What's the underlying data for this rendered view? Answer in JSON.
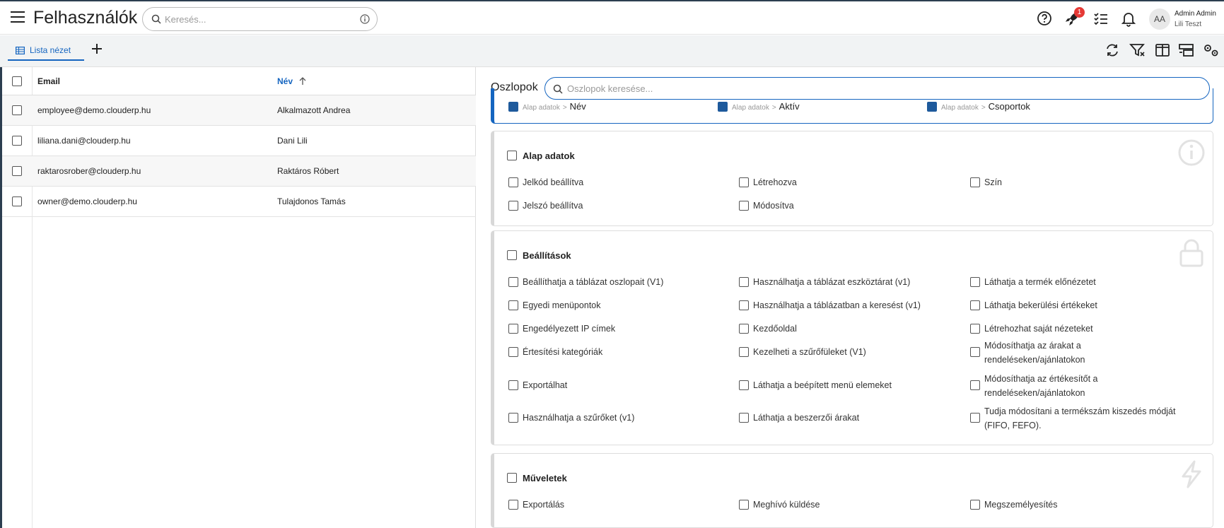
{
  "header": {
    "title": "Felhasználók",
    "search_placeholder": "Keresés...",
    "notification_badge": "1",
    "avatar_initials": "AA",
    "user_name": "Admin Admin",
    "user_company": "Lili Teszt"
  },
  "toolbar": {
    "tab_label": "Lista nézet"
  },
  "table": {
    "col_email": "Email",
    "col_name": "Név",
    "rows": [
      {
        "email": "employee@demo.clouderp.hu",
        "name": "Alkalmazott Andrea"
      },
      {
        "email": "liliana.dani@clouderp.hu",
        "name": "Dani Lili"
      },
      {
        "email": "raktarosrober@clouderp.hu",
        "name": "Raktáros Róbert"
      },
      {
        "email": "owner@demo.clouderp.hu",
        "name": "Tulajdonos Tamás"
      }
    ]
  },
  "panel": {
    "title": "Oszlopok",
    "search_placeholder": "Oszlopok keresése...",
    "selected": [
      {
        "path": "Alap adatok",
        "sep": ">",
        "label": "Név"
      },
      {
        "path": "Alap adatok",
        "sep": ">",
        "label": "Aktív"
      },
      {
        "path": "Alap adatok",
        "sep": ">",
        "label": "Csoportok"
      }
    ],
    "groups": [
      {
        "title": "Alap adatok",
        "icon": "info-icon",
        "options": [
          "Jelkód beállítva",
          "Létrehozva",
          "Szín",
          "Jelszó beállítva",
          "Módosítva"
        ]
      },
      {
        "title": "Beállítások",
        "icon": "lock-icon",
        "options": [
          "Beállíthatja a táblázat oszlopait (V1)",
          "Használhatja a táblázat eszköztárat (v1)",
          "Láthatja a termék előnézetet",
          "Egyedi menüpontok",
          "Használhatja a táblázatban a keresést (v1)",
          "Láthatja bekerülési értékeket",
          "Engedélyezett IP címek",
          "Kezdőoldal",
          "Létrehozhat saját nézeteket",
          "Értesítési kategóriák",
          "Kezelheti a szűrőfüleket (V1)",
          "Módosíthatja az árakat a rendeléseken/ajánlatokon",
          "Exportálhat",
          "Láthatja a beépített menü elemeket",
          "Módosíthatja az értékesítőt a rendeléseken/ajánlatokon",
          "Használhatja a szűrőket (v1)",
          "Láthatja a beszerzői árakat",
          "Tudja módosítani a termékszám kiszedés módját (FIFO, FEFO)."
        ]
      },
      {
        "title": "Műveletek",
        "icon": "lightning-icon",
        "options": [
          "Exportálás",
          "Meghívó küldése",
          "Megszemélyesítés"
        ]
      }
    ]
  }
}
